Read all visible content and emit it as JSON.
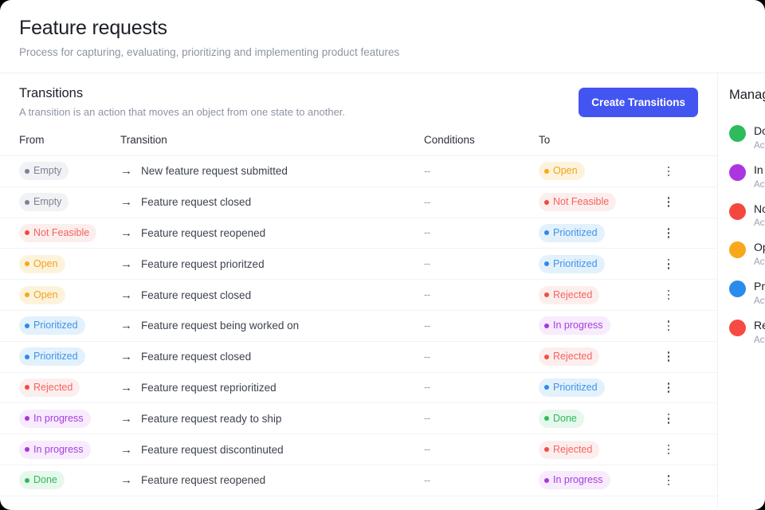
{
  "page": {
    "title": "Feature requests",
    "subtitle": "Process for capturing, evaluating, prioritizing and implementing product features"
  },
  "section": {
    "heading": "Transitions",
    "description": "A transition is an action that moves an object from one state to another.",
    "create_button": "Create Transitions"
  },
  "table": {
    "columns": {
      "from": "From",
      "transition": "Transition",
      "conditions": "Conditions",
      "to": "To"
    },
    "arrow_glyph": "→",
    "rows": [
      {
        "from": "Empty",
        "from_style": "bg-empty",
        "transition": "New feature request submitted",
        "conditions": "--",
        "to": "Open",
        "to_style": "bg-open"
      },
      {
        "from": "Empty",
        "from_style": "bg-empty",
        "transition": "Feature request closed",
        "conditions": "--",
        "to": "Not Feasible",
        "to_style": "bg-notfeasible"
      },
      {
        "from": "Not Feasible",
        "from_style": "bg-notfeasible",
        "transition": "Feature request reopened",
        "conditions": "--",
        "to": "Prioritized",
        "to_style": "bg-prioritized"
      },
      {
        "from": "Open",
        "from_style": "bg-open",
        "transition": "Feature request prioritzed",
        "conditions": "--",
        "to": "Prioritized",
        "to_style": "bg-prioritized"
      },
      {
        "from": "Open",
        "from_style": "bg-open",
        "transition": "Feature request closed",
        "conditions": "--",
        "to": "Rejected",
        "to_style": "bg-rejected"
      },
      {
        "from": "Prioritized",
        "from_style": "bg-prioritized",
        "transition": "Feature request being worked on",
        "conditions": "--",
        "to": "In progress",
        "to_style": "bg-inprogress"
      },
      {
        "from": "Prioritized",
        "from_style": "bg-prioritized",
        "transition": "Feature request closed",
        "conditions": "--",
        "to": "Rejected",
        "to_style": "bg-rejected"
      },
      {
        "from": "Rejected",
        "from_style": "bg-rejected",
        "transition": "Feature request reprioritized",
        "conditions": "--",
        "to": "Prioritized",
        "to_style": "bg-prioritized"
      },
      {
        "from": "In progress",
        "from_style": "bg-inprogress",
        "transition": "Feature request ready to ship",
        "conditions": "--",
        "to": "Done",
        "to_style": "bg-done"
      },
      {
        "from": "In progress",
        "from_style": "bg-inprogress",
        "transition": "Feature request discontinuted",
        "conditions": "--",
        "to": "Rejected",
        "to_style": "bg-rejected"
      },
      {
        "from": "Done",
        "from_style": "bg-done",
        "transition": "Feature request reopened",
        "conditions": "--",
        "to": "In progress",
        "to_style": "bg-inprogress"
      }
    ]
  },
  "side_panel": {
    "title": "Manage states",
    "items": [
      {
        "name": "Done",
        "sub": "Active",
        "color": "#2ebb5b"
      },
      {
        "name": "In progress",
        "sub": "Active",
        "color": "#ab36e0"
      },
      {
        "name": "Not Feasible",
        "sub": "Active",
        "color": "#f4483f"
      },
      {
        "name": "Open",
        "sub": "Active",
        "color": "#f8a81b"
      },
      {
        "name": "Prioritized",
        "sub": "Active",
        "color": "#2b8bea"
      },
      {
        "name": "Rejected",
        "sub": "Active",
        "color": "#f64b43"
      }
    ]
  },
  "colors": {
    "accent": "#4355f0",
    "text_primary": "#1b1f27",
    "text_muted": "#8d94a3",
    "border": "#eef0f3"
  }
}
